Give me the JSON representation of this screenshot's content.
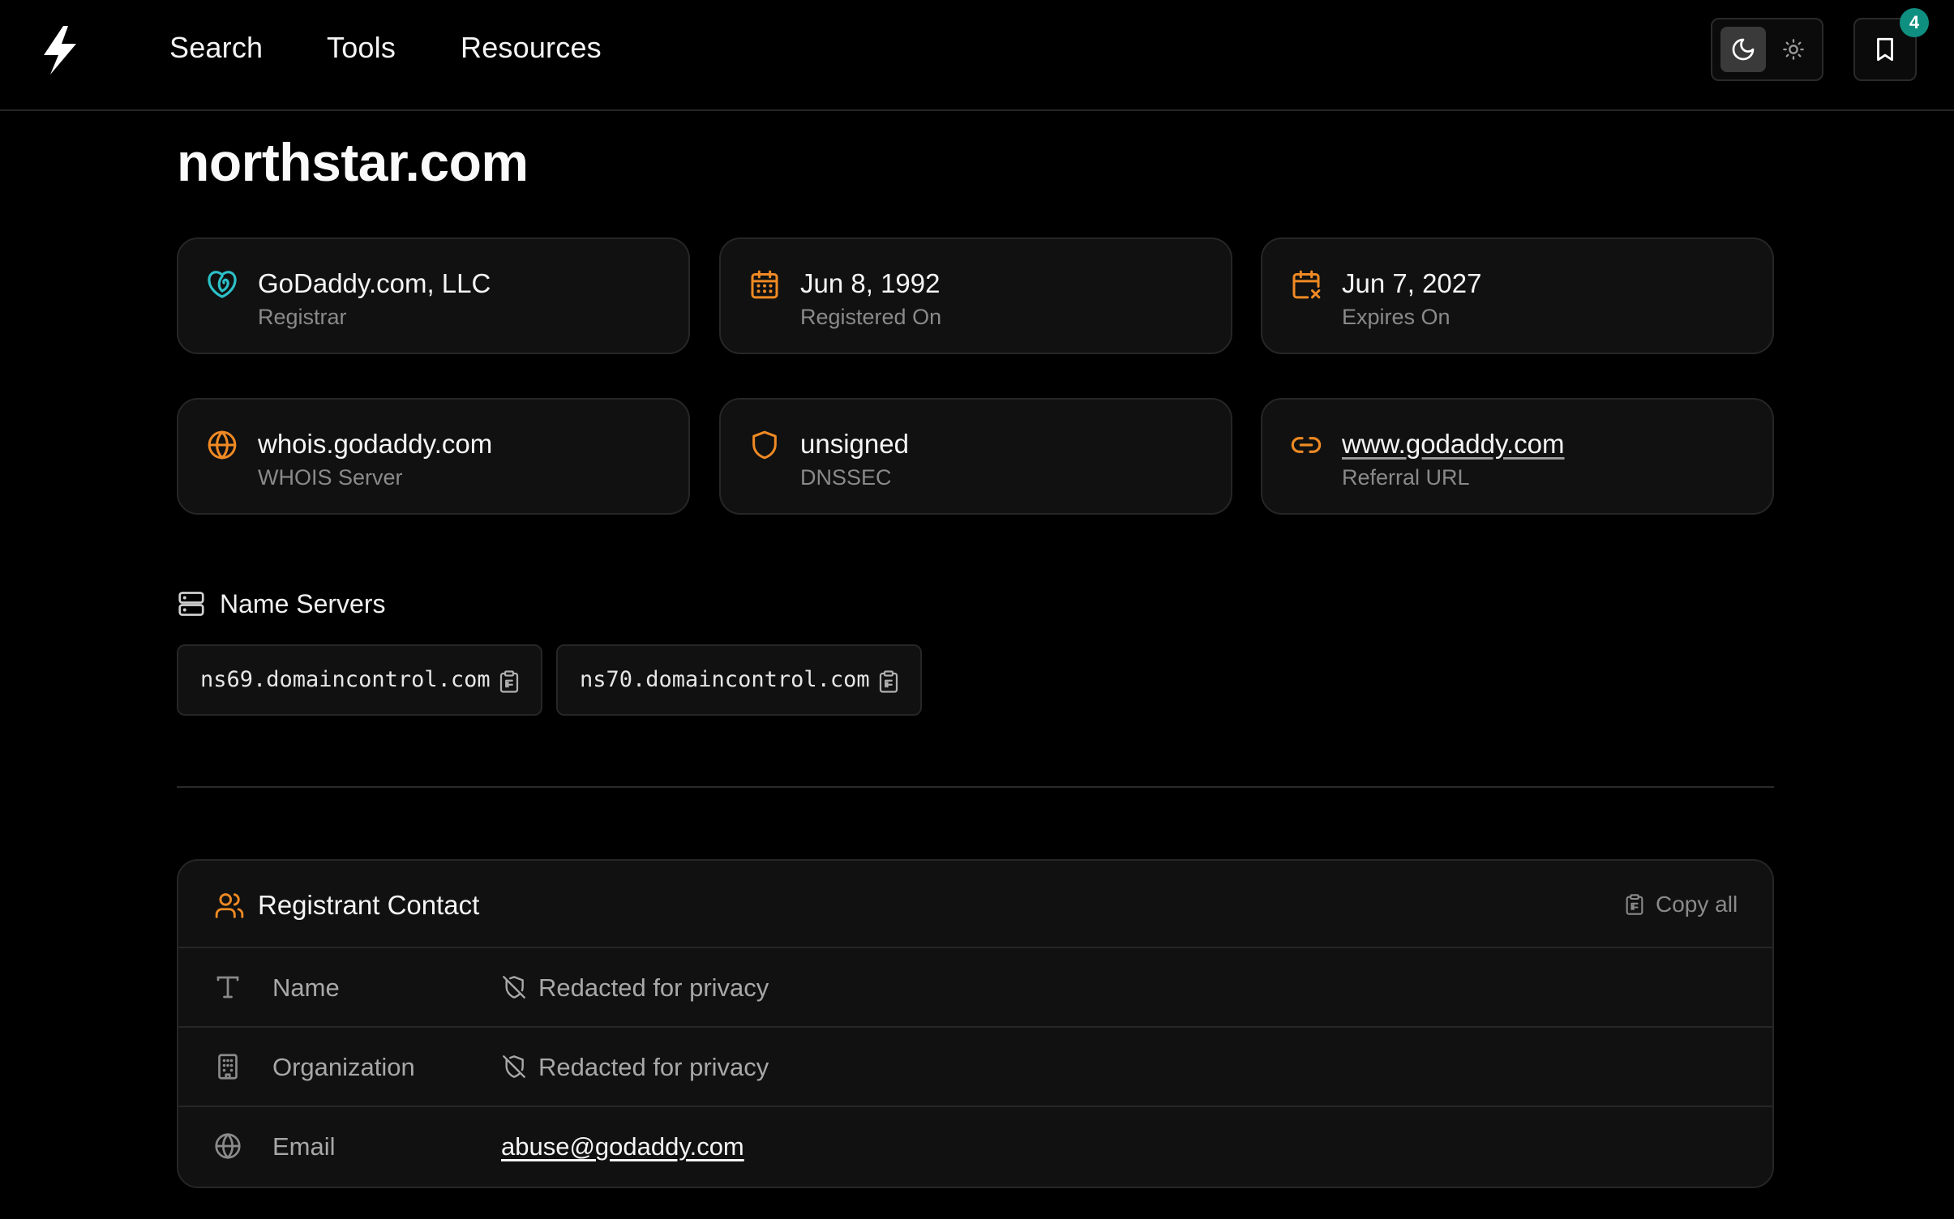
{
  "header": {
    "logo": "bolt-logo",
    "nav": [
      "Search",
      "Tools",
      "Resources"
    ],
    "theme_toggle": {
      "options": [
        "dark",
        "light"
      ],
      "selected": "dark"
    },
    "bookmarks_count": "4"
  },
  "domain": "northstar.com",
  "info_cards": [
    {
      "value": "GoDaddy.com, LLC",
      "label": "Registrar",
      "icon": "godaddy-logo-icon"
    },
    {
      "value": "Jun 8, 1992",
      "label": "Registered On",
      "icon": "calendar-icon"
    },
    {
      "value": "Jun 7, 2027",
      "label": "Expires On",
      "icon": "calendar-x-icon"
    },
    {
      "value": "whois.godaddy.com",
      "label": "WHOIS Server",
      "icon": "globe-icon"
    },
    {
      "value": "unsigned",
      "label": "DNSSEC",
      "icon": "shield-icon"
    },
    {
      "value": "www.godaddy.com",
      "label": "Referral URL",
      "icon": "link-icon"
    }
  ],
  "name_servers": {
    "heading": "Name Servers",
    "items": [
      "ns69.domaincontrol.com",
      "ns70.domaincontrol.com"
    ]
  },
  "registrant_contact": {
    "title": "Registrant Contact",
    "copy_all_label": "Copy all",
    "rows": [
      {
        "label": "Name",
        "value": "Redacted for privacy",
        "icon": "text-icon"
      },
      {
        "label": "Organization",
        "value": "Redacted for privacy",
        "icon": "building-icon"
      },
      {
        "label": "Email",
        "value": "abuse@godaddy.com",
        "icon": "globe-icon"
      }
    ]
  },
  "colors": {
    "background": "#000000",
    "card": "#111111",
    "border": "#262626",
    "accent_orange": "#f08a24",
    "accent_teal": "#2cc1c9",
    "badge": "#0f8f80"
  }
}
